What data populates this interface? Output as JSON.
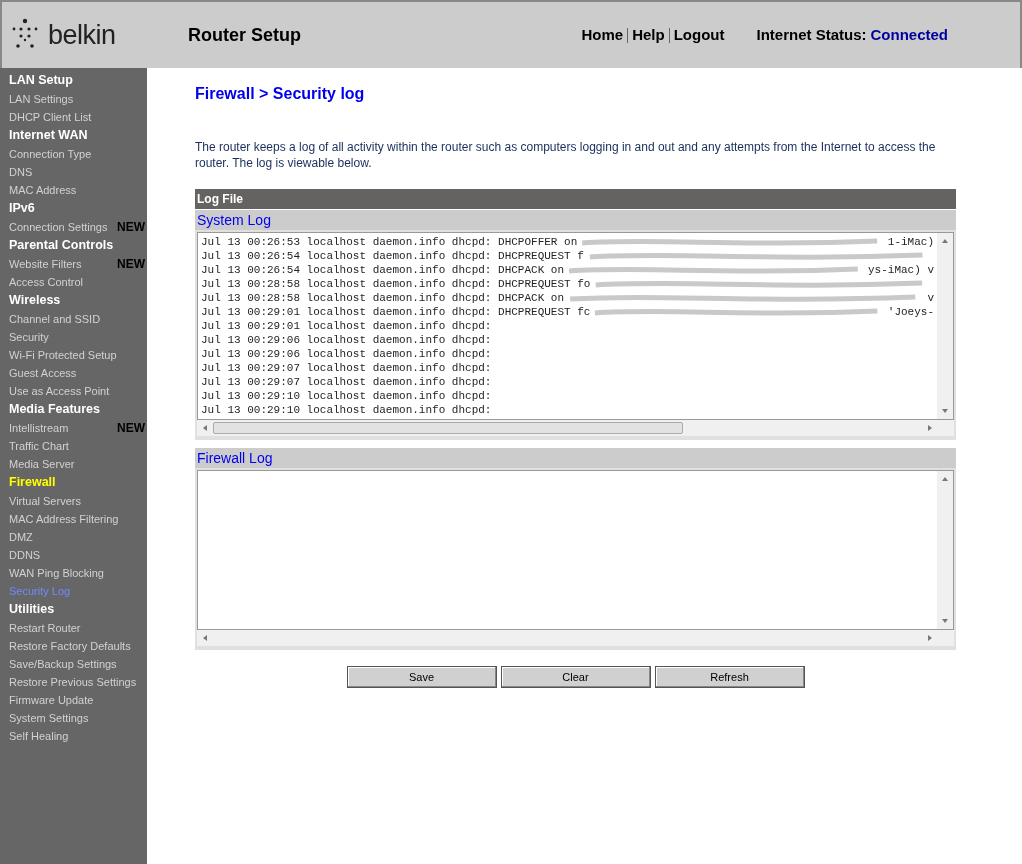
{
  "header": {
    "logo": "belkin",
    "title": "Router Setup",
    "links": [
      "Home",
      "Help",
      "Logout"
    ],
    "status_label": "Internet Status:",
    "status_value": "Connected"
  },
  "sidebar": {
    "items": [
      {
        "kind": "heading",
        "label": "LAN Setup",
        "selected": false
      },
      {
        "kind": "link",
        "label": "LAN Settings",
        "selected": false
      },
      {
        "kind": "link",
        "label": "DHCP Client List",
        "selected": false
      },
      {
        "kind": "heading",
        "label": "Internet WAN",
        "selected": false
      },
      {
        "kind": "link",
        "label": "Connection Type",
        "selected": false
      },
      {
        "kind": "link",
        "label": "DNS",
        "selected": false
      },
      {
        "kind": "link",
        "label": "MAC Address",
        "selected": false
      },
      {
        "kind": "heading",
        "label": "IPv6",
        "selected": false
      },
      {
        "kind": "link",
        "label": "Connection Settings",
        "selected": false,
        "badge": "NEW"
      },
      {
        "kind": "heading",
        "label": "Parental Controls",
        "selected": false
      },
      {
        "kind": "link",
        "label": "Website Filters",
        "selected": false,
        "badge": "NEW"
      },
      {
        "kind": "link",
        "label": "Access Control",
        "selected": false
      },
      {
        "kind": "heading",
        "label": "Wireless",
        "selected": false
      },
      {
        "kind": "link",
        "label": "Channel and SSID",
        "selected": false
      },
      {
        "kind": "link",
        "label": "Security",
        "selected": false
      },
      {
        "kind": "link",
        "label": "Wi-Fi Protected Setup",
        "selected": false
      },
      {
        "kind": "link",
        "label": "Guest Access",
        "selected": false
      },
      {
        "kind": "link",
        "label": "Use as Access Point",
        "selected": false
      },
      {
        "kind": "heading",
        "label": "Media Features",
        "selected": false
      },
      {
        "kind": "link",
        "label": "Intellistream",
        "selected": false,
        "badge": "NEW"
      },
      {
        "kind": "link",
        "label": "Traffic Chart",
        "selected": false
      },
      {
        "kind": "link",
        "label": "Media Server",
        "selected": false
      },
      {
        "kind": "heading",
        "label": "Firewall",
        "selected": true
      },
      {
        "kind": "link",
        "label": "Virtual Servers",
        "selected": false
      },
      {
        "kind": "link",
        "label": "MAC Address Filtering",
        "selected": false
      },
      {
        "kind": "link",
        "label": "DMZ",
        "selected": false
      },
      {
        "kind": "link",
        "label": "DDNS",
        "selected": false
      },
      {
        "kind": "link",
        "label": "WAN Ping Blocking",
        "selected": false
      },
      {
        "kind": "link",
        "label": "Security Log",
        "selected": true
      },
      {
        "kind": "heading",
        "label": "Utilities",
        "selected": false
      },
      {
        "kind": "link",
        "label": "Restart Router",
        "selected": false
      },
      {
        "kind": "link",
        "label": "Restore Factory Defaults",
        "selected": false
      },
      {
        "kind": "link",
        "label": "Save/Backup Settings",
        "selected": false
      },
      {
        "kind": "link",
        "label": "Restore Previous Settings",
        "selected": false
      },
      {
        "kind": "link",
        "label": "Firmware Update",
        "selected": false
      },
      {
        "kind": "link",
        "label": "System Settings",
        "selected": false
      },
      {
        "kind": "link",
        "label": "Self Healing",
        "selected": false
      }
    ]
  },
  "page": {
    "breadcrumb": "Firewall > Security log",
    "intro": "The router keeps a log of all activity within the router such as computers logging in and out and any attempts from the Internet to access the router. The log is viewable below.",
    "section_title": "Log File",
    "system_log": {
      "title": "System Log",
      "lines": [
        {
          "text": "Jul 13 00:26:53 localhost daemon.info dhcpd: DHCPOFFER on",
          "tail": "1-iMac)",
          "redacted": true
        },
        {
          "text": "Jul 13 00:26:54 localhost daemon.info dhcpd: DHCPREQUEST f",
          "redacted": true
        },
        {
          "text": "Jul 13 00:26:54 localhost daemon.info dhcpd: DHCPACK on",
          "tail": "ys-iMac) v",
          "redacted": true
        },
        {
          "text": "Jul 13 00:28:58 localhost daemon.info dhcpd: DHCPREQUEST fo",
          "redacted": true
        },
        {
          "text": "Jul 13 00:28:58 localhost daemon.info dhcpd: DHCPACK on",
          "tail": "v",
          "redacted": true
        },
        {
          "text": "Jul 13 00:29:01 localhost daemon.info dhcpd: DHCPREQUEST fc",
          "tail": "'Joeys-",
          "redacted": true
        },
        {
          "text": "Jul 13 00:29:01 localhost daemon.info dhcpd:",
          "redacted": false
        },
        {
          "text": "Jul 13 00:29:06 localhost daemon.info dhcpd:",
          "redacted": false
        },
        {
          "text": "Jul 13 00:29:06 localhost daemon.info dhcpd:",
          "redacted": false
        },
        {
          "text": "Jul 13 00:29:07 localhost daemon.info dhcpd:",
          "redacted": false
        },
        {
          "text": "Jul 13 00:29:07 localhost daemon.info dhcpd:",
          "redacted": false
        },
        {
          "text": "Jul 13 00:29:10 localhost daemon.info dhcpd:",
          "redacted": false
        },
        {
          "text": "Jul 13 00:29:10 localhost daemon.info dhcpd:",
          "redacted": false
        }
      ]
    },
    "firewall_log": {
      "title": "Firewall Log"
    },
    "buttons": [
      "Save",
      "Clear",
      "Refresh"
    ]
  }
}
